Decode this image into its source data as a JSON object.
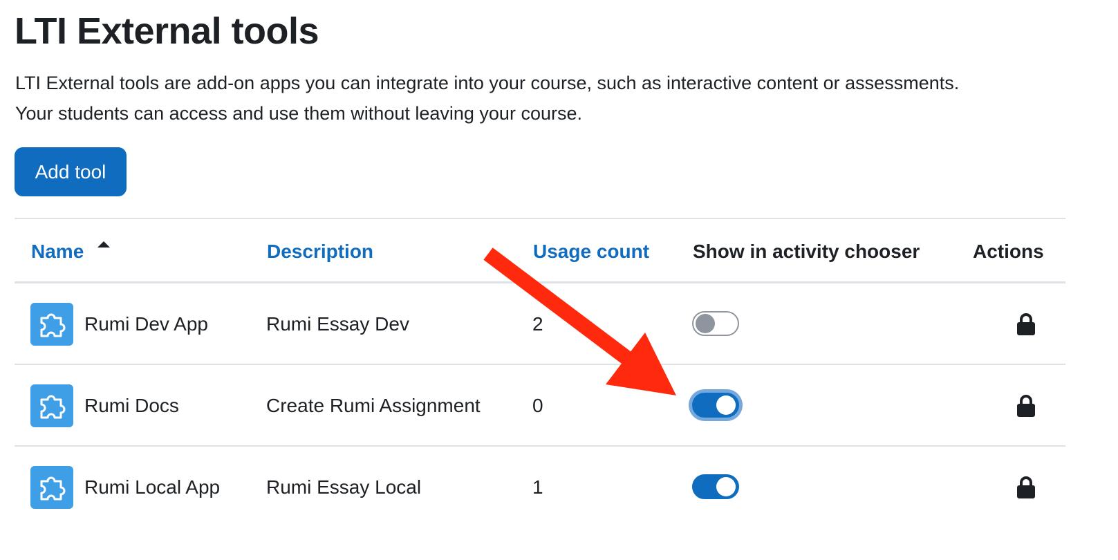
{
  "page": {
    "title": "LTI External tools",
    "description_line1": "LTI External tools are add-on apps you can integrate into your course, such as interactive content or assessments.",
    "description_line2": "Your students can access and use them without leaving your course."
  },
  "toolbar": {
    "add_label": "Add tool"
  },
  "table": {
    "headers": {
      "name": "Name",
      "description": "Description",
      "usage": "Usage count",
      "show": "Show in activity chooser",
      "actions": "Actions"
    },
    "sort": {
      "column": "name",
      "direction": "ascending"
    },
    "rows": [
      {
        "name": "Rumi Dev App",
        "description": "Rumi Essay Dev",
        "usage": "2",
        "show_in_chooser": false,
        "icon": "puzzle-icon",
        "action_icon": "lock-icon"
      },
      {
        "name": "Rumi Docs",
        "description": "Create Rumi Assignment",
        "usage": "0",
        "show_in_chooser": true,
        "focused": true,
        "icon": "puzzle-icon",
        "action_icon": "lock-icon"
      },
      {
        "name": "Rumi Local App",
        "description": "Rumi Essay Local",
        "usage": "1",
        "show_in_chooser": true,
        "icon": "puzzle-icon",
        "action_icon": "lock-icon"
      }
    ]
  },
  "colors": {
    "accent": "#0f6cbf",
    "icon_bg": "#3e9fe6",
    "annotation_arrow": "#ff2a0d"
  },
  "annotation": {
    "type": "arrow",
    "points_to": "Rumi Docs show-in-activity-chooser toggle"
  }
}
